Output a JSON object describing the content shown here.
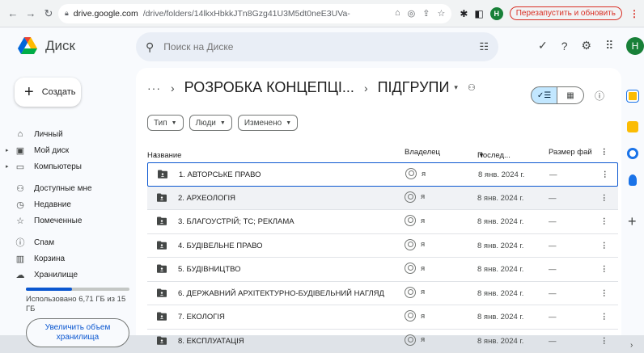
{
  "browser": {
    "back_icon": "arrow-left-icon",
    "url_host": "drive.google.com",
    "url_path": "/drive/folders/14lkxHbkkJTn8Gzg41U3M5dt0neE3UVa-",
    "profile_letter": "Н",
    "restart_label": "Перезапустить и обновить"
  },
  "app": {
    "name": "Диск",
    "search_placeholder": "Поиск на Диске",
    "avatar_letter": "Н"
  },
  "sidebar": {
    "create_label": "Создать",
    "items": [
      {
        "label": "Личный",
        "icon": "home-icon"
      },
      {
        "label": "Мой диск",
        "icon": "my-drive-icon"
      },
      {
        "label": "Компьютеры",
        "icon": "computer-icon"
      },
      {
        "label": "Доступные мне",
        "icon": "shared-icon"
      },
      {
        "label": "Недавние",
        "icon": "clock-icon"
      },
      {
        "label": "Помеченные",
        "icon": "star-icon"
      },
      {
        "label": "Спам",
        "icon": "spam-icon"
      },
      {
        "label": "Корзина",
        "icon": "trash-icon"
      },
      {
        "label": "Хранилище",
        "icon": "cloud-icon"
      }
    ],
    "storage_text": "Использовано 6,71 ГБ из 15 ГБ",
    "storage_fraction": 0.447,
    "upgrade_label": "Увеличить объем хранилища"
  },
  "main": {
    "breadcrumb_more": "···",
    "breadcrumb_parent": "РОЗРОБКА КОНЦЕПЦІ...",
    "breadcrumb_current": "ПІДГРУПИ",
    "filters": [
      "Тип",
      "Люди",
      "Изменено"
    ],
    "columns": {
      "name": "Название",
      "sort_arrow": "↑",
      "owner": "Владелец",
      "modified": "Послед...",
      "modified_arrow": "▾",
      "size": "Размер фай"
    },
    "rows": [
      {
        "name": "1. АВТОРСЬКЕ ПРАВО",
        "owner": "я",
        "date": "8 янв. 2024 г.",
        "size": "—"
      },
      {
        "name": "2. АРХЕОЛОГІЯ",
        "owner": "я",
        "date": "8 янв. 2024 г.",
        "size": "—"
      },
      {
        "name": "3. БЛАГОУСТРІЙ; ТС; РЕКЛАМА",
        "owner": "я",
        "date": "8 янв. 2024 г.",
        "size": "—"
      },
      {
        "name": "4. БУДІВЕЛЬНЕ ПРАВО",
        "owner": "я",
        "date": "8 янв. 2024 г.",
        "size": "—"
      },
      {
        "name": "5. БУДІВНИЦТВО",
        "owner": "я",
        "date": "8 янв. 2024 г.",
        "size": "—"
      },
      {
        "name": "6. ДЕРЖАВНИЙ АРХІТЕКТУРНО-БУДІВЕЛЬНИЙ НАГЛЯД",
        "owner": "я",
        "date": "8 янв. 2024 г.",
        "size": "—"
      },
      {
        "name": "7. ЕКОЛОГІЯ",
        "owner": "я",
        "date": "8 янв. 2024 г.",
        "size": "—"
      },
      {
        "name": "8. ЕКСПЛУАТАЦІЯ",
        "owner": "я",
        "date": "8 янв. 2024 г.",
        "size": "—"
      }
    ]
  },
  "colors": {
    "accent": "#0b57d0",
    "selected_view": "#c2e7ff",
    "restart": "#d93025",
    "avatar": "#188038"
  }
}
